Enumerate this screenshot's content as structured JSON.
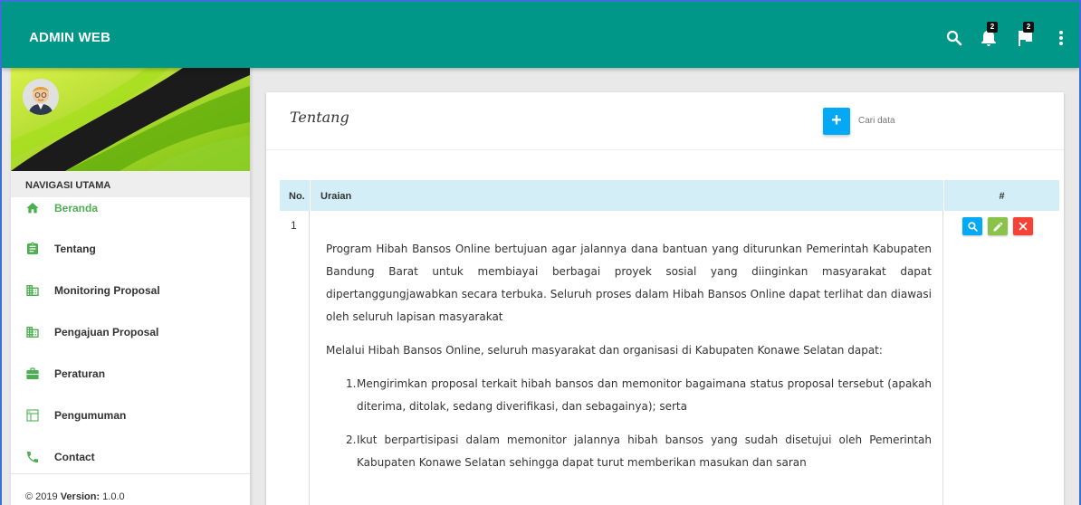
{
  "header": {
    "brand": "ADMIN WEB",
    "notifications_count": "2",
    "tasks_count": "2",
    "accent_color": "#009688"
  },
  "sidebar": {
    "nav_header": "NAVIGASI UTAMA",
    "items": [
      {
        "label": "Beranda",
        "icon": "home-icon",
        "active": true
      },
      {
        "label": "Tentang",
        "icon": "assignment-icon"
      },
      {
        "label": "Monitoring Proposal",
        "icon": "business-icon"
      },
      {
        "label": "Pengajuan Proposal",
        "icon": "business-icon"
      },
      {
        "label": "Peraturan",
        "icon": "work-icon"
      },
      {
        "label": "Pengumuman",
        "icon": "dns-icon"
      },
      {
        "label": "Contact",
        "icon": "phone-icon"
      }
    ],
    "footer": {
      "copyright": "© 2019",
      "version_label": "Version:",
      "version": "1.0.0"
    }
  },
  "card": {
    "title": "Tentang",
    "add_label": "+",
    "search_placeholder": "Cari data",
    "table": {
      "headers": {
        "no": "No.",
        "uraian": "Uraian",
        "actions": "#"
      },
      "rows": [
        {
          "no": "1",
          "paragraphs": [
            "Program Hibah Bansos Online bertujuan agar jalannya dana bantuan yang diturunkan Pemerintah Kabupaten Bandung Barat untuk membiayai berbagai proyek sosial yang diinginkan masyarakat dapat dipertanggungjawabkan secara terbuka. Seluruh proses dalam Hibah Bansos Online dapat terlihat dan diawasi oleh seluruh lapisan masyarakat",
            "Melalui Hibah Bansos Online, seluruh masyarakat dan organisasi di Kabupaten Konawe Selatan dapat:"
          ],
          "list": [
            {
              "num": "1.",
              "text": "Mengirimkan proposal terkait hibah bansos dan memonitor bagaimana status proposal tersebut (apakah diterima, ditolak, sedang diverifikasi, dan sebagainya); serta"
            },
            {
              "num": "2.",
              "text": "Ikut berpartisipasi dalam memonitor jalannya hibah bansos yang sudah disetujui oleh Pemerintah Kabupaten Konawe Selatan sehingga dapat turut memberikan masukan dan saran"
            }
          ]
        }
      ]
    }
  }
}
